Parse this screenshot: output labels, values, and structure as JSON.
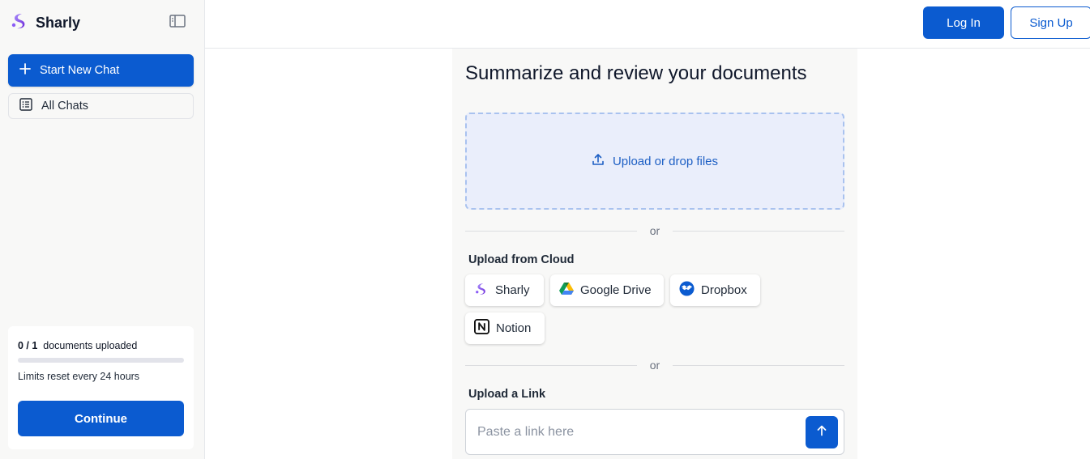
{
  "brand": {
    "name": "Sharly"
  },
  "sidebar": {
    "new_chat_label": "Start New Chat",
    "all_chats_label": "All Chats",
    "usage": {
      "count": "0 / 1",
      "label": "documents uploaded",
      "progress_fraction": 0,
      "reset_note": "Limits reset every 24 hours",
      "continue_label": "Continue"
    }
  },
  "header": {
    "login_label": "Log In",
    "signup_label": "Sign Up"
  },
  "main": {
    "title": "Summarize and review your documents",
    "dropzone_label": "Upload or drop files",
    "divider_or": "or",
    "cloud_section_label": "Upload from Cloud",
    "cloud_sources": [
      {
        "label": "Sharly",
        "icon": "sharly-logo-icon"
      },
      {
        "label": "Google Drive",
        "icon": "google-drive-icon"
      },
      {
        "label": "Dropbox",
        "icon": "dropbox-icon"
      },
      {
        "label": "Notion",
        "icon": "notion-icon"
      }
    ],
    "link_section_label": "Upload a Link",
    "link_placeholder": "Paste a link here"
  },
  "colors": {
    "primary": "#0b5bd0",
    "dropzone_bg": "#eaeefb",
    "dropzone_border": "#a9c2ef",
    "panel_bg": "#f8f8f7",
    "brand_purple": "#7c3aed"
  }
}
